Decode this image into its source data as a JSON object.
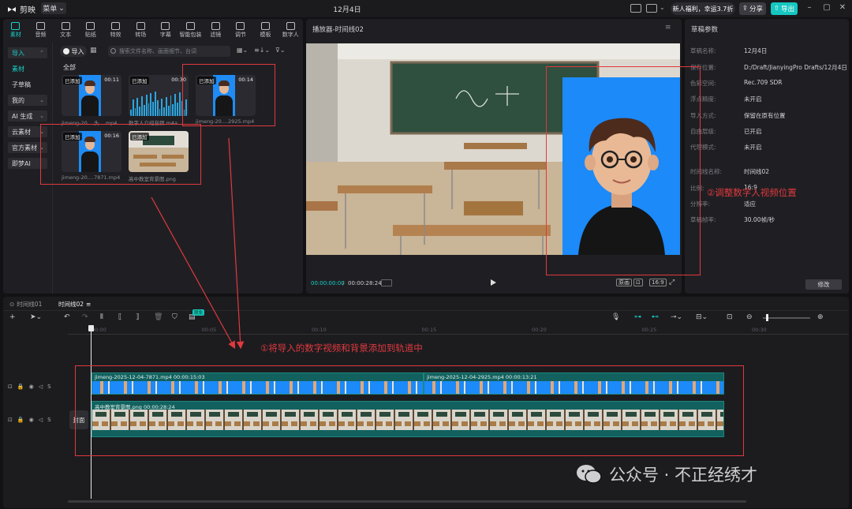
{
  "app": {
    "name": "剪映",
    "menu_label": "菜单",
    "title": "12月4日",
    "promo": "新人福利，幸运3.7折",
    "share": "分享",
    "export": "导出"
  },
  "media_tabs": [
    "素材",
    "音频",
    "文本",
    "贴纸",
    "特效",
    "转场",
    "字幕",
    "智能包装",
    "滤镜",
    "调节",
    "模板",
    "数字人"
  ],
  "sidebar": {
    "items": [
      {
        "label": "导入",
        "chevron": "⌃",
        "boxed": true,
        "active": true
      },
      {
        "label": "素材",
        "chevron": "",
        "boxed": false,
        "active": true
      },
      {
        "label": "子草稿",
        "chevron": "",
        "boxed": false,
        "active": false
      },
      {
        "label": "我的",
        "chevron": "⌄",
        "boxed": true,
        "active": false
      },
      {
        "label": "AI 生成",
        "chevron": "⌄",
        "boxed": true,
        "active": false
      },
      {
        "label": "云素材",
        "chevron": "⌄",
        "boxed": true,
        "active": false
      },
      {
        "label": "官方素材",
        "chevron": "⌄",
        "boxed": true,
        "active": false
      },
      {
        "label": "即梦AI",
        "chevron": "",
        "boxed": true,
        "active": false
      }
    ]
  },
  "media": {
    "import_label": "导入",
    "search_placeholder": "搜索文件名称、画面细节、台词",
    "all_label": "全部",
    "added_badge": "已添加",
    "items": [
      {
        "name": "jimeng-20... 头 ...mp4",
        "duration": "00:11",
        "kind": "avatar"
      },
      {
        "name": "数字人介绍音频.m4a",
        "duration": "00:30",
        "kind": "audio"
      },
      {
        "name": "jimeng-20....2925.mp4",
        "duration": "00:14",
        "kind": "avatar"
      },
      {
        "name": "jimeng-20....7871.mp4",
        "duration": "00:16",
        "kind": "avatar"
      },
      {
        "name": "高中教室背景图.png",
        "duration": "",
        "kind": "classroom"
      }
    ]
  },
  "player": {
    "title": "播放器-时间线02",
    "current_time": "00:00:00:00",
    "total_time": "00:00:28:24",
    "ratio_label": "16:9",
    "full_label": "原画"
  },
  "props": {
    "title": "草稿参数",
    "rows": [
      {
        "label": "草稿名称:",
        "value": "12月4日"
      },
      {
        "label": "保存位置:",
        "value": "D:/Draft/JianyingPro Drafts/12月4日"
      },
      {
        "label": "色彩空间:",
        "value": "Rec.709 SDR"
      },
      {
        "label": "浮点精度:",
        "value": "未开启"
      },
      {
        "label": "导入方式:",
        "value": "保留在原有位置"
      },
      {
        "label": "自由层级:",
        "value": "已开启"
      },
      {
        "label": "代理模式:",
        "value": "未开启"
      },
      {
        "label": "时间线名称:",
        "value": "时间线02"
      },
      {
        "label": "比例:",
        "value": "16:9"
      },
      {
        "label": "分辨率:",
        "value": "适应"
      },
      {
        "label": "草稿帧率:",
        "value": "30.00帧/秒"
      }
    ],
    "modify": "修改"
  },
  "timeline": {
    "tabs": [
      "时间线01",
      "时间线02"
    ],
    "ruler": [
      "00:00",
      "00:05",
      "00:10",
      "00:15",
      "00:20",
      "00:25",
      "00:30"
    ],
    "cover_label": "封面",
    "tool_badge": "限免",
    "clips": [
      {
        "label": "jimeng-2025-12-04-7871.mp4  00:00:15:03"
      },
      {
        "label": "jimeng-2025-12-04-2925.mp4  00:00:13:21"
      },
      {
        "label": "高中教室背景图.png  00:00:28:24"
      }
    ]
  },
  "annotations": {
    "step1": "①将导入的数字视频和背景添加到轨道中",
    "step2": "②调整数字人视频位置"
  },
  "watermark": "公众号 · 不正经绣才",
  "colors": {
    "accent": "#17d0c8",
    "annotation": "#e0393e"
  }
}
